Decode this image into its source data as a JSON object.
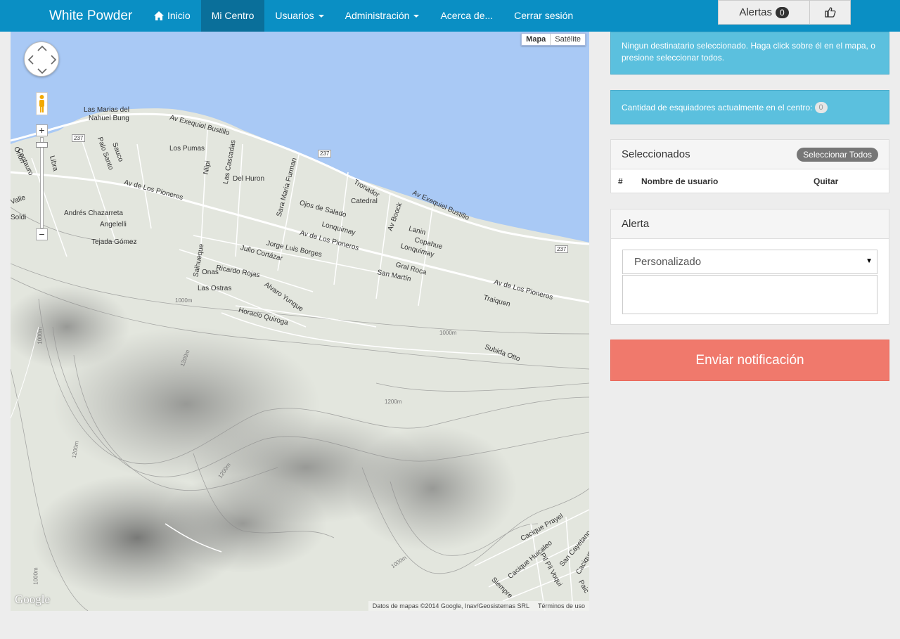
{
  "navbar": {
    "brand": "White Powder",
    "items": [
      {
        "label": "Inicio"
      },
      {
        "label": "Mi Centro"
      },
      {
        "label": "Usuarios"
      },
      {
        "label": "Administración"
      },
      {
        "label": "Acerca de..."
      },
      {
        "label": "Cerrar sesión"
      }
    ],
    "alerts_label": "Alertas",
    "alerts_count": "0",
    "color": "#0a8fc4"
  },
  "map": {
    "type_map": "Mapa",
    "type_satellite": "Satélite",
    "logo": "Google",
    "attribution": "Datos de mapas ©2014 Google, Inav/Geosistemas SRL",
    "terms": "Términos de uso",
    "labels": [
      "Las Marias del",
      "Nahuel Bung",
      "Av Exequiel Bustillo",
      "Los Pumas",
      "Nilpi",
      "Las Cascadas",
      "Del Huron",
      "Sara Maria Furman",
      "Tronador",
      "Catedral",
      "Av Boock",
      "Av Exequiel Bustillo",
      "Orion",
      "Centauro",
      "Palo Santo",
      "Sauco",
      "Libra",
      "Av de Los Pioneros",
      "Valle",
      "Soldi",
      "Andrés Chazarreta",
      "Angelelli",
      "Tejada Gómez",
      "Ojos de Salado",
      "Lonquimay",
      "Av de Los Pioneros",
      "Lanin",
      "Copahue",
      "Lonquimay",
      "Jorge Luis Borges",
      "Julio Cortázar",
      "Saihueque",
      "Onas",
      "Ricardo Rojas",
      "Gral Roca",
      "San Martín",
      "Las Ostras",
      "Alvaro Yunque",
      "Horacio Quiroga",
      "Av de Los Pioneros",
      "Traiquen",
      "Subida Otto",
      "Cacique Prayel",
      "Cacique Huicaleo",
      "Pil Pil Voqui",
      "San Cayetano",
      "Siempre",
      "Cacique",
      "Paic",
      "1000m",
      "1000m",
      "1000m",
      "1000m",
      "1000m",
      "1200m",
      "1200m",
      "1200m",
      "1200m",
      "237",
      "237",
      "237"
    ]
  },
  "alerts": {
    "no_recipient": "Ningun destinatario seleccionado. Haga click sobre él en el mapa, o presione seleccionar todos.",
    "skiers_label": "Cantidad de esquiadores actualmente en el centro:",
    "skiers_count": "0",
    "info_color": "#5bc0de"
  },
  "selected_panel": {
    "title": "Seleccionados",
    "select_all": "Seleccionar Todos",
    "columns": [
      "#",
      "Nombre de usuario",
      "Quitar"
    ]
  },
  "alert_panel": {
    "title": "Alerta",
    "select_value": "Personalizado",
    "message": ""
  },
  "send_button": {
    "label": "Enviar notificación",
    "color": "#f0796c"
  }
}
